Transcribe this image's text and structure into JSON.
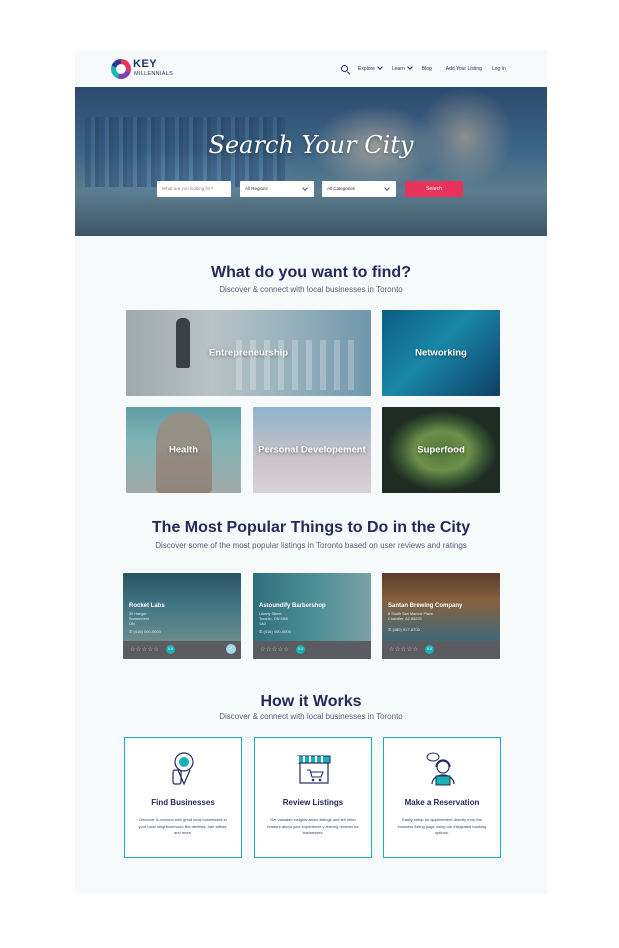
{
  "header": {
    "logo_text": "KEY",
    "logo_sub": "MILLENNIALS",
    "nav": [
      "Explore",
      "Learn",
      "Blog",
      "Add Your Listing",
      "Log In"
    ]
  },
  "hero": {
    "title": "Search Your City",
    "keyword_placeholder": "What are you looking for?",
    "region_value": "All Regions",
    "category_value": "All Categories",
    "search_label": "Search"
  },
  "find": {
    "title": "What do you want to find?",
    "subtitle": "Discover & connect with local businesses in Toronto",
    "categories": [
      "Entrepreneurship",
      "Networking",
      "Health",
      "Personal Developement",
      "Superfood"
    ]
  },
  "popular": {
    "title": "The Most Popular Things to Do in the City",
    "subtitle": "Discover some of the most popular listings in Toronto based on user reviews and ratings",
    "listings": [
      {
        "name": "Rocket Labs",
        "address1": "30 Hanger",
        "address2": "Somewhere",
        "address3": "ON",
        "phone": "(416) 000-0000",
        "rating": "0.0",
        "stars": "☆☆☆☆☆"
      },
      {
        "name": "Astoundify Barbershop",
        "address1": "Liberty Street",
        "address2": "Toronto, ON M6K",
        "address3": "1A0",
        "phone": "(416) 000-0000",
        "rating": "0.0",
        "stars": "☆☆☆☆☆"
      },
      {
        "name": "Santan Brewing Company",
        "address1": "8 South San Marcos Place",
        "address2": "Chandler, AZ 85225",
        "address3": "",
        "phone": "(480) 917-8700",
        "rating": "0.0",
        "stars": "☆☆☆☆☆"
      }
    ]
  },
  "how": {
    "title": "How it Works",
    "subtitle": "Discover & connect with local businesses in Toronto",
    "steps": [
      {
        "title": "Find Businesses",
        "text": "Discover & connect with great local businesses in your local neighbourhood like dentists, hair stilists, and more."
      },
      {
        "title": "Review Listings",
        "text": "Get valuable insights about listings and tell other readers about your experience y leaving reviews for businesses."
      },
      {
        "title": "Make a Reservation",
        "text": "Easily setup an appointment directly from the business listing page using our integrated booking options."
      }
    ]
  },
  "colors": {
    "accent": "#e8345c",
    "teal": "#1bb0b7",
    "navy": "#232a5c"
  }
}
